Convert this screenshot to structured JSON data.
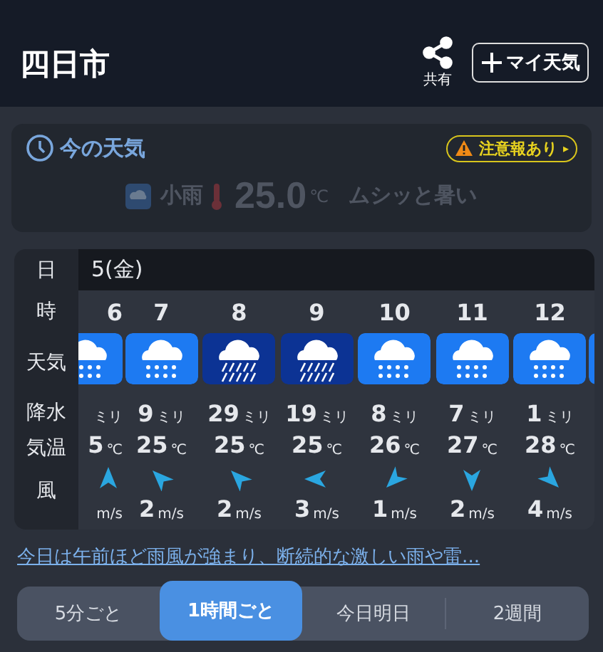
{
  "header": {
    "title": "四日市",
    "share_label": "共有",
    "my_weather_button": "マイ天気"
  },
  "current": {
    "title": "今の天気",
    "alert": "注意報あり",
    "alert_arrow": "▸",
    "condition": "小雨",
    "temperature": "25.0",
    "temp_unit": "℃",
    "comment": "ムシッと暑い"
  },
  "forecast": {
    "row_labels": {
      "date": "日",
      "hour": "時",
      "weather": "天気",
      "precip": "降水",
      "temp": "気温",
      "wind": "風"
    },
    "date": "5(金)",
    "columns": [
      {
        "hour": "6",
        "icon": {
          "kind": "rain"
        },
        "precip_unit": "ミリ",
        "temp": "5",
        "temp_unit": "℃",
        "wind_arrow": {
          "kind": "n"
        },
        "wind_unit": "m/s"
      },
      {
        "hour": "7",
        "icon": {
          "kind": "rain"
        },
        "precip": "9",
        "precip_unit": "ミリ",
        "temp": "25",
        "temp_unit": "℃",
        "wind_arrow": {
          "kind": "nw"
        },
        "wind_speed": "2",
        "wind_unit": "m/s"
      },
      {
        "hour": "8",
        "icon": {
          "kind": "downpour"
        },
        "precip": "29",
        "precip_unit": "ミリ",
        "temp": "25",
        "temp_unit": "℃",
        "wind_arrow": {
          "kind": "nw"
        },
        "wind_speed": "2",
        "wind_unit": "m/s"
      },
      {
        "hour": "9",
        "icon": {
          "kind": "downpour"
        },
        "precip": "19",
        "precip_unit": "ミリ",
        "temp": "25",
        "temp_unit": "℃",
        "wind_arrow": {
          "kind": "w"
        },
        "wind_speed": "3",
        "wind_unit": "m/s"
      },
      {
        "hour": "10",
        "icon": {
          "kind": "rain"
        },
        "precip": "8",
        "precip_unit": "ミリ",
        "temp": "26",
        "temp_unit": "℃",
        "wind_arrow": {
          "kind": "sw"
        },
        "wind_speed": "1",
        "wind_unit": "m/s"
      },
      {
        "hour": "11",
        "icon": {
          "kind": "rain"
        },
        "precip": "7",
        "precip_unit": "ミリ",
        "temp": "27",
        "temp_unit": "℃",
        "wind_arrow": {
          "kind": "s"
        },
        "wind_speed": "2",
        "wind_unit": "m/s"
      },
      {
        "hour": "12",
        "icon": {
          "kind": "rain"
        },
        "precip": "1",
        "precip_unit": "ミリ",
        "temp": "28",
        "temp_unit": "℃",
        "wind_arrow": {
          "kind": "se"
        },
        "wind_speed": "4",
        "wind_unit": "m/s"
      },
      {
        "icon": {
          "kind": "rain"
        }
      }
    ]
  },
  "summary_link": "今日は午前ほど雨風が強まり、断続的な激しい雨や雷...",
  "tabs": [
    {
      "label": "5分ごと",
      "selected": false
    },
    {
      "label": "1時間ごと",
      "selected": true
    },
    {
      "label": "今日明日",
      "selected": false
    },
    {
      "label": "2週間",
      "selected": false
    }
  ]
}
